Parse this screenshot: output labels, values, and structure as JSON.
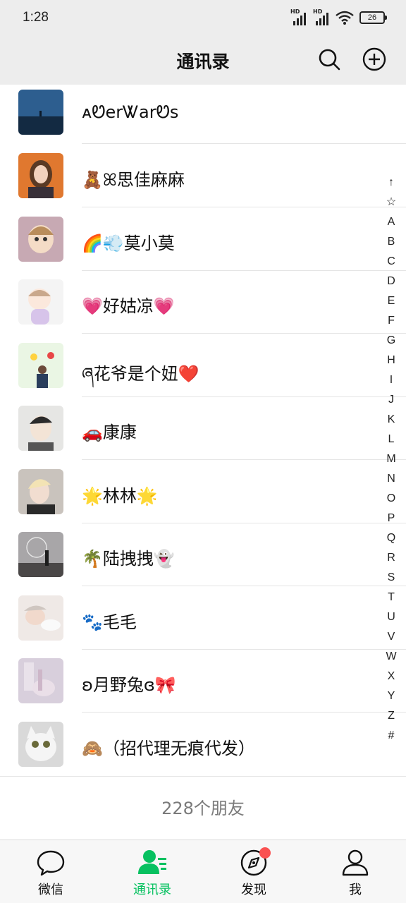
{
  "status": {
    "time": "1:28",
    "battery": "26",
    "hd1": "HD",
    "hd2": "HD"
  },
  "header": {
    "title": "通讯录"
  },
  "contacts": [
    {
      "name": "ᴀᏬerᏔarᏬs",
      "avatar_icon": "sea-landscape-avatar"
    },
    {
      "name": "🧸ꕤ思佳麻麻",
      "avatar_icon": "anime-girl-avatar"
    },
    {
      "name": "🌈💨莫小莫",
      "avatar_icon": "cartoon-girl-avatar"
    },
    {
      "name": "💗好姑凉💗",
      "avatar_icon": "cartoon-kid-avatar"
    },
    {
      "name": "ཞ花爷是个妞❤️",
      "avatar_icon": "balloons-avatar"
    },
    {
      "name": "🚗康康",
      "avatar_icon": "cartoon-boy-avatar"
    },
    {
      "name": "🌟林林🌟",
      "avatar_icon": "blond-boy-avatar"
    },
    {
      "name": "🌴陆拽拽👻",
      "avatar_icon": "ferris-wheel-avatar"
    },
    {
      "name": "🐾毛毛",
      "avatar_icon": "sleeping-girl-avatar"
    },
    {
      "name": "ʚ月野兔ɞ🎀",
      "avatar_icon": "pink-room-avatar"
    },
    {
      "name": "🙈（招代理无痕代发）",
      "avatar_icon": "white-cat-avatar"
    }
  ],
  "footer": {
    "count": "228个朋友"
  },
  "index": [
    "↑",
    "☆",
    "A",
    "B",
    "C",
    "D",
    "E",
    "F",
    "G",
    "H",
    "I",
    "J",
    "K",
    "L",
    "M",
    "N",
    "O",
    "P",
    "Q",
    "R",
    "S",
    "T",
    "U",
    "V",
    "W",
    "X",
    "Y",
    "Z",
    "#"
  ],
  "tabs": [
    {
      "label": "微信",
      "icon": "chat-bubble-icon"
    },
    {
      "label": "通讯录",
      "icon": "contacts-icon"
    },
    {
      "label": "发现",
      "icon": "compass-icon"
    },
    {
      "label": "我",
      "icon": "person-icon"
    }
  ],
  "colors": {
    "accent": "#07c160",
    "badge": "#fa5151",
    "background": "#ededed"
  }
}
